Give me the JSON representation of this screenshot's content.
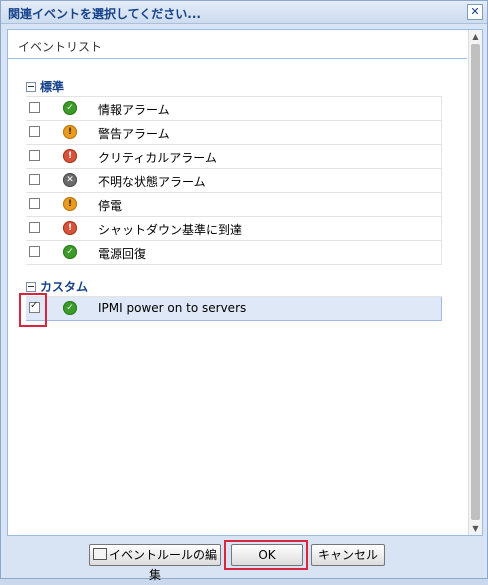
{
  "dialog": {
    "title": "関連イベントを選択してください...",
    "close_glyph": "✕"
  },
  "panel": {
    "header": "イベントリスト"
  },
  "groups": [
    {
      "name": "標準",
      "items": [
        {
          "label": "情報アラーム",
          "status": "ok",
          "glyph": "✓",
          "checked": false
        },
        {
          "label": "警告アラーム",
          "status": "warn",
          "glyph": "!",
          "checked": false
        },
        {
          "label": "クリティカルアラーム",
          "status": "crit",
          "glyph": "!",
          "checked": false
        },
        {
          "label": "不明な状態アラーム",
          "status": "unk",
          "glyph": "✕",
          "checked": false
        },
        {
          "label": "停電",
          "status": "warn",
          "glyph": "!",
          "checked": false
        },
        {
          "label": "シャットダウン基準に到達",
          "status": "crit",
          "glyph": "!",
          "checked": false
        },
        {
          "label": "電源回復",
          "status": "ok",
          "glyph": "✓",
          "checked": false
        }
      ]
    },
    {
      "name": "カスタム",
      "items": [
        {
          "label": "IPMI power on to servers",
          "status": "ok",
          "glyph": "✓",
          "checked": true,
          "selected": true
        }
      ]
    }
  ],
  "buttons": {
    "edit_rules": "イベントルールの編集",
    "ok": "OK",
    "cancel": "キャンセル"
  },
  "colors": {
    "highlight": "#d7263d",
    "ok": "#3a9b28",
    "warn": "#e99b1c",
    "crit": "#d9533a",
    "unknown": "#6b6b6b"
  }
}
